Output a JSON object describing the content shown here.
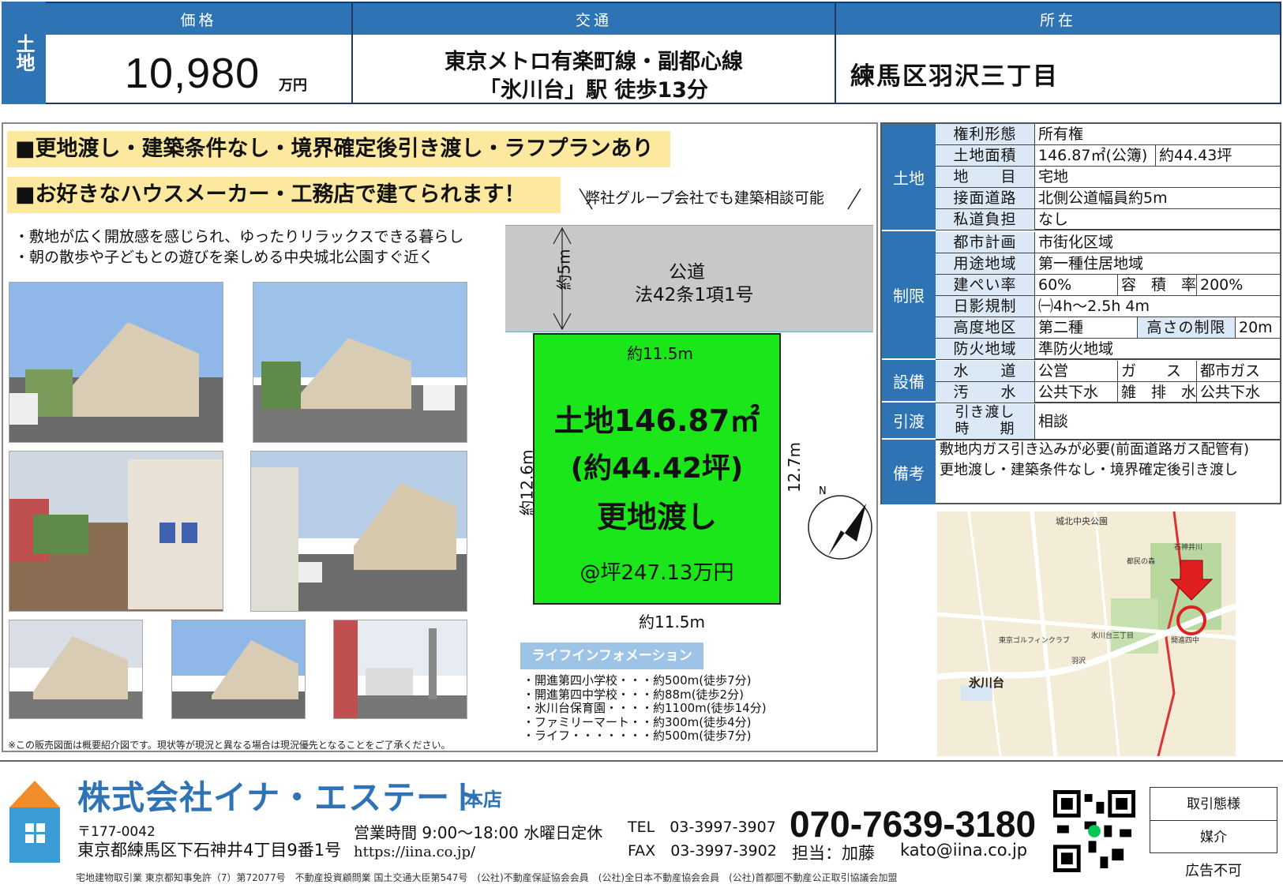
{
  "header": {
    "type_label": "土地",
    "price": {
      "caption": "価格",
      "value": "10,980",
      "unit": "万円"
    },
    "access": {
      "caption": "交通",
      "line1": "東京メトロ有楽町線・副都心線",
      "line2": "「氷川台」駅 徒歩13分"
    },
    "location": {
      "caption": "所在",
      "address": "練馬区羽沢三丁目"
    }
  },
  "banners": {
    "b1": "■更地渡し・建築条件なし・境界確定後引き渡し・ラフプランあり",
    "b2": "■お好きなハウスメーカー・工務店で建てられます！",
    "consult": "弊社グループ会社でも建築相談可能"
  },
  "bullets": [
    "・敷地が広く開放感を感じられ、ゆったりリラックスできる暮らし",
    "・朝の散歩や子どもとの遊びを楽しめる中央城北公園すぐ近く"
  ],
  "diagram": {
    "road_name": "公道",
    "road_law": "法42条1項1号",
    "road_width": "約5m",
    "side_top": "約11.5m",
    "side_bottom": "約11.5m",
    "side_left": "約12.6m",
    "side_right": "12.7m",
    "area": "土地146.87㎡",
    "tsubo": "(約44.42坪)",
    "delivery": "更地渡し",
    "unit_price": "@坪247.13万円",
    "north": "N"
  },
  "life_info": {
    "title": "ライフインフォメーション",
    "items": [
      "・開進第四小学校・・・約500m(徒歩7分)",
      "・開進第四中学校・・・約88m(徒歩2分)",
      "・氷川台保育園・・・・約1100m(徒歩14分)",
      "・ファミリーマート・・約300m(徒歩4分)",
      "・ライフ・・・・・・・約500m(徒歩7分)"
    ]
  },
  "disclaimer": "※この販売図面は概要紹介図です。現状等が現況と異なる場合は現況優先となることをご了承ください。",
  "spec": {
    "groups": {
      "land": "土地",
      "restrict": "制限",
      "equip": "設備",
      "handover": "引渡",
      "remarks": "備考"
    },
    "rows": {
      "rights": {
        "label": "権利形態",
        "value": "所有権"
      },
      "area": {
        "label": "土地面積",
        "value": "146.87㎡(公簿)",
        "value2": "約44.43坪"
      },
      "category": {
        "label": "地　　目",
        "value": "宅地"
      },
      "road": {
        "label": "接面道路",
        "value": "北側公道幅員約5m"
      },
      "private": {
        "label": "私道負担",
        "value": "なし"
      },
      "city": {
        "label": "都市計画",
        "value": "市街化区域"
      },
      "zone": {
        "label": "用途地域",
        "value": "第一種住居地域"
      },
      "coverage": {
        "label": "建ぺい率",
        "value": "60%",
        "label2": "容　積　率",
        "value2": "200%"
      },
      "shadow": {
        "label": "日影規制",
        "value": "㈠4h～2.5h 4m"
      },
      "height": {
        "label": "高度地区",
        "value": "第二種",
        "label2": "高さの制限",
        "value2": "20m"
      },
      "fire": {
        "label": "防火地域",
        "value": "準防火地域"
      },
      "water": {
        "label": "水　　道",
        "value": "公営",
        "label2": "ガ　　ス",
        "value2": "都市ガス"
      },
      "sewage": {
        "label": "汚　　水",
        "value": "公共下水",
        "label2": "雑　排　水",
        "value2": "公共下水"
      },
      "timing": {
        "label1": "引き渡し",
        "label2": "時　　期",
        "value": "相談"
      }
    },
    "remarks": [
      "敷地内ガス引き込みが必要(前面道路ガス配管有)",
      "更地渡し・建築条件なし・境界確定後引き渡し"
    ]
  },
  "map": {
    "labels": [
      "城北中央公園",
      "氷川台",
      "開進四中",
      "東京ゴルフィンクラブ",
      "石神井川",
      "氷川台三丁目",
      "羽沢",
      "都民の森"
    ]
  },
  "footer": {
    "company": "株式会社イナ・エステート",
    "branch": "本店",
    "zip": "〒177-0042",
    "address": "東京都練馬区下石神井4丁目9番1号",
    "hours": "営業時間 9:00～18:00 水曜日定休",
    "url": "https://iina.co.jp/",
    "tel": "TEL　03-3997-3907",
    "fax": "FAX　03-3997-3902",
    "phone": "070-7639-3180",
    "staff": "担当：加藤",
    "email": "kato@iina.co.jp",
    "trade_label": "取引態様",
    "trade_value": "媒介",
    "no_ad": "広告不可",
    "license": "宅地建物取引業 東京都知事免許（7）第72077号　不動産投資顧問業 国土交通大臣第547号　(公社)不動産保証協会会員　(公社)全日本不動産協会会員　(公社)首都圏不動産公正取引協議会加盟"
  },
  "colors": {
    "accent": "#2e74b5",
    "banner": "#fde8a0",
    "lot": "#1ae61a",
    "road": "#c8c8c8",
    "label_bg": "#dbe8f5"
  }
}
